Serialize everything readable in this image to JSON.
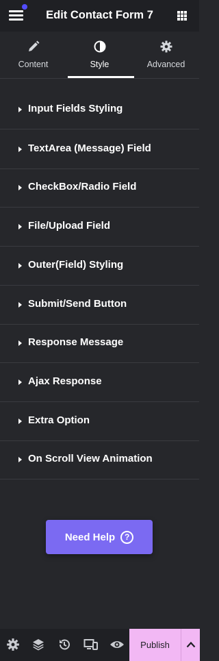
{
  "header": {
    "title": "Edit Contact Form 7",
    "notification_dot_color": "#524cff",
    "menu_icon": "hamburger-icon",
    "apps_icon": "grid-icon"
  },
  "tabs": [
    {
      "label": "Content",
      "icon": "pencil-icon"
    },
    {
      "label": "Style",
      "icon": "contrast-icon",
      "active": true
    },
    {
      "label": "Advanced",
      "icon": "gear-icon"
    }
  ],
  "sections": [
    {
      "label": "Input Fields Styling"
    },
    {
      "label": "TextArea (Message) Field"
    },
    {
      "label": "CheckBox/Radio Field"
    },
    {
      "label": "File/Upload Field"
    },
    {
      "label": "Outer(Field) Styling"
    },
    {
      "label": "Submit/Send Button"
    },
    {
      "label": "Response Message"
    },
    {
      "label": "Ajax Response"
    },
    {
      "label": "Extra Option"
    },
    {
      "label": "On Scroll View Animation"
    }
  ],
  "help": {
    "label": "Need Help",
    "icon": "question-circle-icon",
    "color": "#7b6af2"
  },
  "footer": {
    "icons": [
      "settings-icon",
      "layers-icon",
      "history-icon",
      "responsive-icon",
      "preview-eye-icon"
    ],
    "publish_label": "Publish",
    "publish_color": "#f2b8f4",
    "arrow_icon": "chevron-up-icon"
  },
  "colors": {
    "background": "#26272b",
    "bar": "#1f2024",
    "divider": "#3a3b40"
  }
}
